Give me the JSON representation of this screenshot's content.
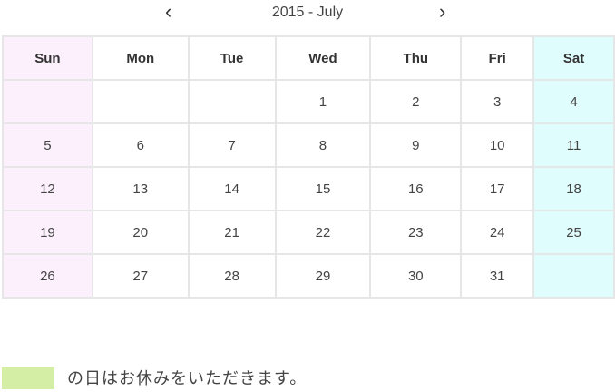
{
  "header": {
    "title": "2015 - July",
    "prev_icon": "chevron-left-icon",
    "next_icon": "chevron-right-icon"
  },
  "calendar": {
    "weekdays": [
      "Sun",
      "Mon",
      "Tue",
      "Wed",
      "Thu",
      "Fri",
      "Sat"
    ],
    "weeks": [
      [
        "",
        "",
        "",
        "1",
        "2",
        "3",
        "4"
      ],
      [
        "5",
        "6",
        "7",
        "8",
        "9",
        "10",
        "11"
      ],
      [
        "12",
        "13",
        "14",
        "15",
        "16",
        "17",
        "18"
      ],
      [
        "19",
        "20",
        "21",
        "22",
        "23",
        "24",
        "25"
      ],
      [
        "26",
        "27",
        "28",
        "29",
        "30",
        "31",
        ""
      ]
    ],
    "colors": {
      "sunday": "#fdf0fd",
      "saturday": "#e0fdfd",
      "border": "#e6e6e6"
    }
  },
  "legend": {
    "text": "の日はお休みをいただきます。",
    "color": "#d4eea6"
  }
}
